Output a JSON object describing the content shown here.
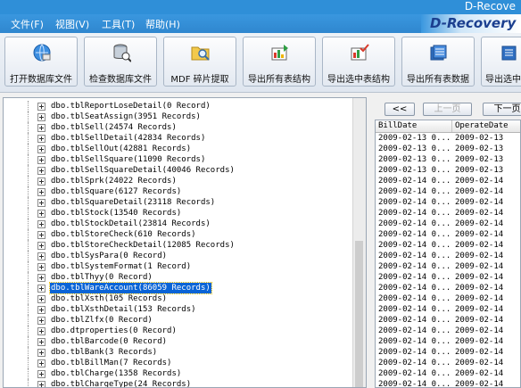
{
  "window": {
    "title": "D-Recove"
  },
  "menu": [
    {
      "label": "文件(F)"
    },
    {
      "label": "视图(V)"
    },
    {
      "label": "工具(T)"
    },
    {
      "label": "帮助(H)"
    }
  ],
  "brand": {
    "text": "D-Recovery"
  },
  "toolbar": [
    {
      "label": "打开数据库文件",
      "icon": "globe-disk-icon"
    },
    {
      "label": "检查数据库文件",
      "icon": "database-check-icon"
    },
    {
      "label": "MDF 碎片提取",
      "icon": "folder-search-icon"
    },
    {
      "label": "导出所有表结构",
      "icon": "export-all-structure-icon"
    },
    {
      "label": "导出选中表结构",
      "icon": "export-selected-structure-icon"
    },
    {
      "label": "导出所有表数据",
      "icon": "export-all-data-icon"
    },
    {
      "label": "导出选中",
      "icon": "export-selected-data-icon"
    }
  ],
  "tree": {
    "selected_index": 17,
    "items": [
      "dbo.tblReportLoseDetail(0 Record)",
      "dbo.tblSeatAssign(3951 Records)",
      "dbo.tblSell(24574 Records)",
      "dbo.tblSellDetail(42834 Records)",
      "dbo.tblSellOut(42881 Records)",
      "dbo.tblSellSquare(11090 Records)",
      "dbo.tblSellSquareDetail(40046 Records)",
      "dbo.tblSprk(24022 Records)",
      "dbo.tblSquare(6127 Records)",
      "dbo.tblSquareDetail(23118 Records)",
      "dbo.tblStock(13540 Records)",
      "dbo.tblStockDetail(23814 Records)",
      "dbo.tblStoreCheck(610 Records)",
      "dbo.tblStoreCheckDetail(12085 Records)",
      "dbo.tblSysPara(0 Record)",
      "dbo.tblSystemFormat(1 Record)",
      "dbo.tblThyy(0 Record)",
      "dbo.tblWareAccount(86059 Records)",
      "dbo.tblXsth(105 Records)",
      "dbo.tblXsthDetail(153 Records)",
      "dbo.tblZlfx(0 Record)",
      "dbo.dtproperties(0 Record)",
      "dbo.tblBarcode(0 Record)",
      "dbo.tblBank(3 Records)",
      "dbo.tblBillMan(7 Records)",
      "dbo.tblCharge(1358 Records)",
      "dbo.tblChargeType(24 Records)"
    ]
  },
  "pager": {
    "first": "<<",
    "prev": "上一页",
    "next": "下一页"
  },
  "grid": {
    "columns": [
      "BillDate",
      "OperateDate"
    ],
    "rows": [
      [
        "2009-02-13 0...",
        "2009-02-13"
      ],
      [
        "2009-02-13 0...",
        "2009-02-13"
      ],
      [
        "2009-02-13 0...",
        "2009-02-13"
      ],
      [
        "2009-02-13 0...",
        "2009-02-13"
      ],
      [
        "2009-02-14 0...",
        "2009-02-14"
      ],
      [
        "2009-02-14 0...",
        "2009-02-14"
      ],
      [
        "2009-02-14 0...",
        "2009-02-14"
      ],
      [
        "2009-02-14 0...",
        "2009-02-14"
      ],
      [
        "2009-02-14 0...",
        "2009-02-14"
      ],
      [
        "2009-02-14 0...",
        "2009-02-14"
      ],
      [
        "2009-02-14 0...",
        "2009-02-14"
      ],
      [
        "2009-02-14 0...",
        "2009-02-14"
      ],
      [
        "2009-02-14 0...",
        "2009-02-14"
      ],
      [
        "2009-02-14 0...",
        "2009-02-14"
      ],
      [
        "2009-02-14 0...",
        "2009-02-14"
      ],
      [
        "2009-02-14 0...",
        "2009-02-14"
      ],
      [
        "2009-02-14 0...",
        "2009-02-14"
      ],
      [
        "2009-02-14 0...",
        "2009-02-14"
      ],
      [
        "2009-02-14 0...",
        "2009-02-14"
      ],
      [
        "2009-02-14 0...",
        "2009-02-14"
      ],
      [
        "2009-02-14 0...",
        "2009-02-14"
      ],
      [
        "2009-02-14 0...",
        "2009-02-14"
      ],
      [
        "2009-02-14 0...",
        "2009-02-14"
      ],
      [
        "2009-02-14 0...",
        "2009-02-14"
      ],
      [
        "2009-02-14 0...",
        "2009-02-14"
      ]
    ]
  }
}
